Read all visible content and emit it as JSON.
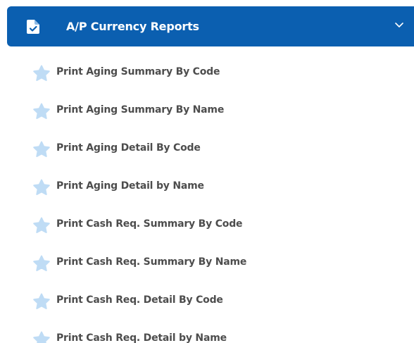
{
  "header": {
    "title": "A/P Currency Reports",
    "icon": "file-check-icon",
    "expand_icon": "chevron-down-icon"
  },
  "colors": {
    "header_bg": "#0b5fb0",
    "header_text": "#ffffff",
    "item_text": "#4d4d4d",
    "star_fill": "#bfdcf5"
  },
  "items": [
    {
      "label": "Print Aging Summary By Code",
      "icon": "star-icon"
    },
    {
      "label": "Print Aging Summary By Name",
      "icon": "star-icon"
    },
    {
      "label": "Print Aging Detail By Code",
      "icon": "star-icon"
    },
    {
      "label": "Print Aging Detail by Name",
      "icon": "star-icon"
    },
    {
      "label": "Print Cash Req. Summary By Code",
      "icon": "star-icon"
    },
    {
      "label": "Print Cash Req. Summary By Name",
      "icon": "star-icon"
    },
    {
      "label": "Print Cash Req. Detail By Code",
      "icon": "star-icon"
    },
    {
      "label": "Print Cash Req. Detail by Name",
      "icon": "star-icon"
    }
  ]
}
